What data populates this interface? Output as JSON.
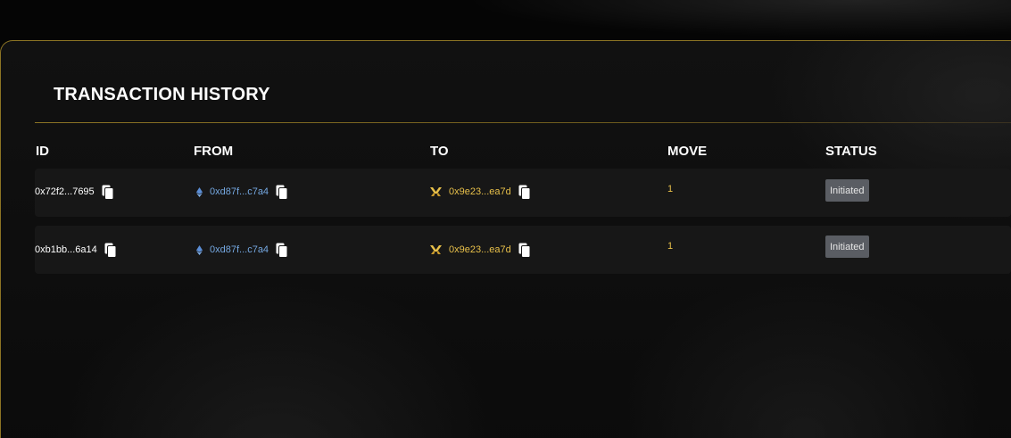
{
  "panel": {
    "title": "TRANSACTION HISTORY"
  },
  "table": {
    "headers": {
      "id": "ID",
      "from": "FROM",
      "to": "TO",
      "move": "MOVE",
      "status": "STATUS"
    },
    "rows": [
      {
        "id": "0x72f2...7695",
        "from": "0xd87f...c7a4",
        "to": "0x9e23...ea7d",
        "move": "1",
        "status": "Initiated"
      },
      {
        "id": "0xb1bb...6a14",
        "from": "0xd87f...c7a4",
        "to": "0x9e23...ea7d",
        "move": "1",
        "status": "Initiated"
      }
    ]
  },
  "colors": {
    "accent_gold": "#e8c04a",
    "link_blue": "#74a7e0",
    "border_gold": "#8c7424",
    "badge_bg": "#5a5d63"
  },
  "icons": {
    "copy": "copy-icon",
    "from_chain": "ethereum-icon",
    "to_chain": "bridge-icon"
  }
}
